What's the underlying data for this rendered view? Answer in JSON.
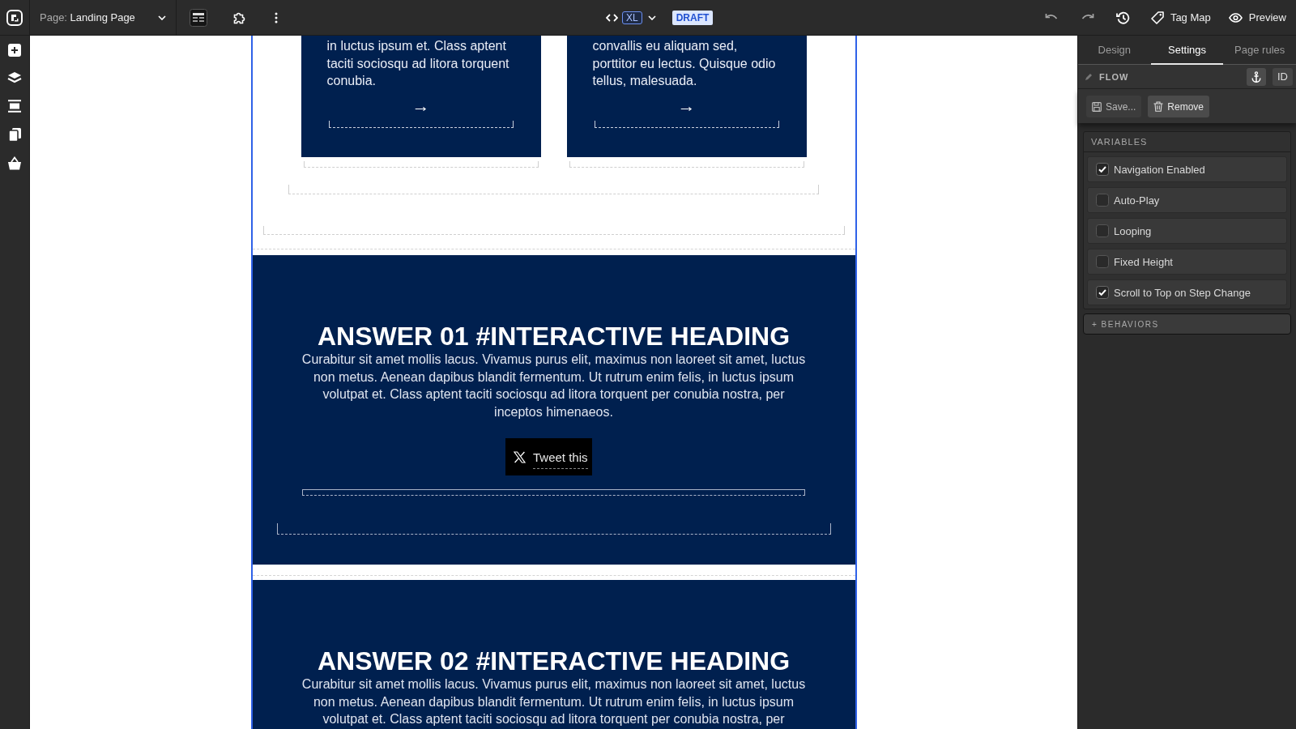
{
  "topbar": {
    "page_prefix": "Page:",
    "page_name": "Landing Page",
    "breakpoint": "XL",
    "status": "DRAFT",
    "actions": [
      {
        "kind": "tag",
        "label": "Tag Map"
      },
      {
        "kind": "preview",
        "label": "Preview"
      }
    ]
  },
  "canvas": {
    "cards": [
      {
        "text": "in luctus ipsum et. Class aptent taciti sociosqu ad litora torquent conubia.",
        "arrow": "→"
      },
      {
        "text": "convallis eu aliquam sed, porttitor eu lectus. Quisque odio tellus, malesuada.",
        "arrow": "→"
      }
    ],
    "sections": [
      {
        "heading": "ANSWER 01 #INTERACTIVE HEADING",
        "body": "Curabitur sit amet mollis lacus. Vivamus purus elit, maximus non laoreet sit amet, luctus non metus. Aenean dapibus blandit fermentum. Ut rutrum enim felis, in luctus ipsum volutpat et. Class aptent taciti sociosqu ad litora torquent per conubia nostra, per inceptos himenaeos.",
        "button": "Tweet this"
      },
      {
        "heading": "ANSWER 02 #INTERACTIVE HEADING",
        "body": "Curabitur sit amet mollis lacus. Vivamus purus elit, maximus non laoreet sit amet, luctus non metus. Aenean dapibus blandit fermentum. Ut rutrum enim felis, in luctus ipsum volutpat et. Class aptent taciti sociosqu ad litora torquent per conubia nostra, per"
      }
    ]
  },
  "panel": {
    "tabs": [
      {
        "label": "Design",
        "selected": false
      },
      {
        "label": "Settings",
        "selected": true
      },
      {
        "label": "Page rules",
        "selected": false
      }
    ],
    "element_label": "FLOW",
    "id_button": "ID",
    "actions": [
      {
        "kind": "save",
        "label": "Save...",
        "hovered": false
      },
      {
        "kind": "remove",
        "label": "Remove",
        "hovered": true
      }
    ],
    "variables": {
      "title": "VARIABLES",
      "items": [
        {
          "label": "Navigation Enabled",
          "checked": true
        },
        {
          "label": "Auto-Play",
          "checked": false
        },
        {
          "label": "Looping",
          "checked": false
        },
        {
          "label": "Fixed Height",
          "checked": false
        },
        {
          "label": "Scroll to Top on Step Change",
          "checked": true
        }
      ]
    },
    "behaviors_button": "+ BEHAVIORS"
  }
}
